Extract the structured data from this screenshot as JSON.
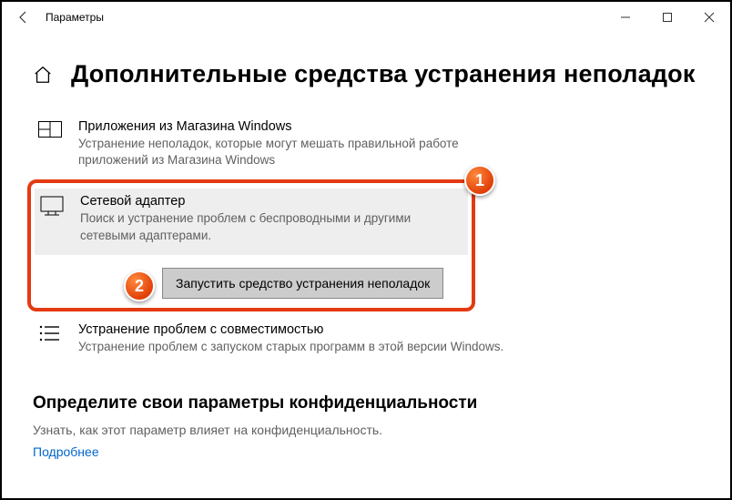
{
  "window": {
    "app_title": "Параметры"
  },
  "page": {
    "title": "Дополнительные средства устранения неполадок"
  },
  "troubleshooters": {
    "store": {
      "title": "Приложения из Магазина Windows",
      "desc": "Устранение неполадок, которые могут мешать правильной работе приложений из Магазина Windows"
    },
    "network": {
      "title": "Сетевой адаптер",
      "desc": "Поиск и устранение проблем с беспроводными и другими сетевыми адаптерами.",
      "run_label": "Запустить средство устранения неполадок"
    },
    "compat": {
      "title": "Устранение проблем с совместимостью",
      "desc": "Устранение проблем с запуском старых программ в этой версии Windows."
    }
  },
  "privacy": {
    "heading": "Определите свои параметры конфиденциальности",
    "desc": "Узнать, как этот параметр влияет на конфиденциальность.",
    "link": "Подробнее"
  },
  "annotations": {
    "badge1": "1",
    "badge2": "2"
  }
}
